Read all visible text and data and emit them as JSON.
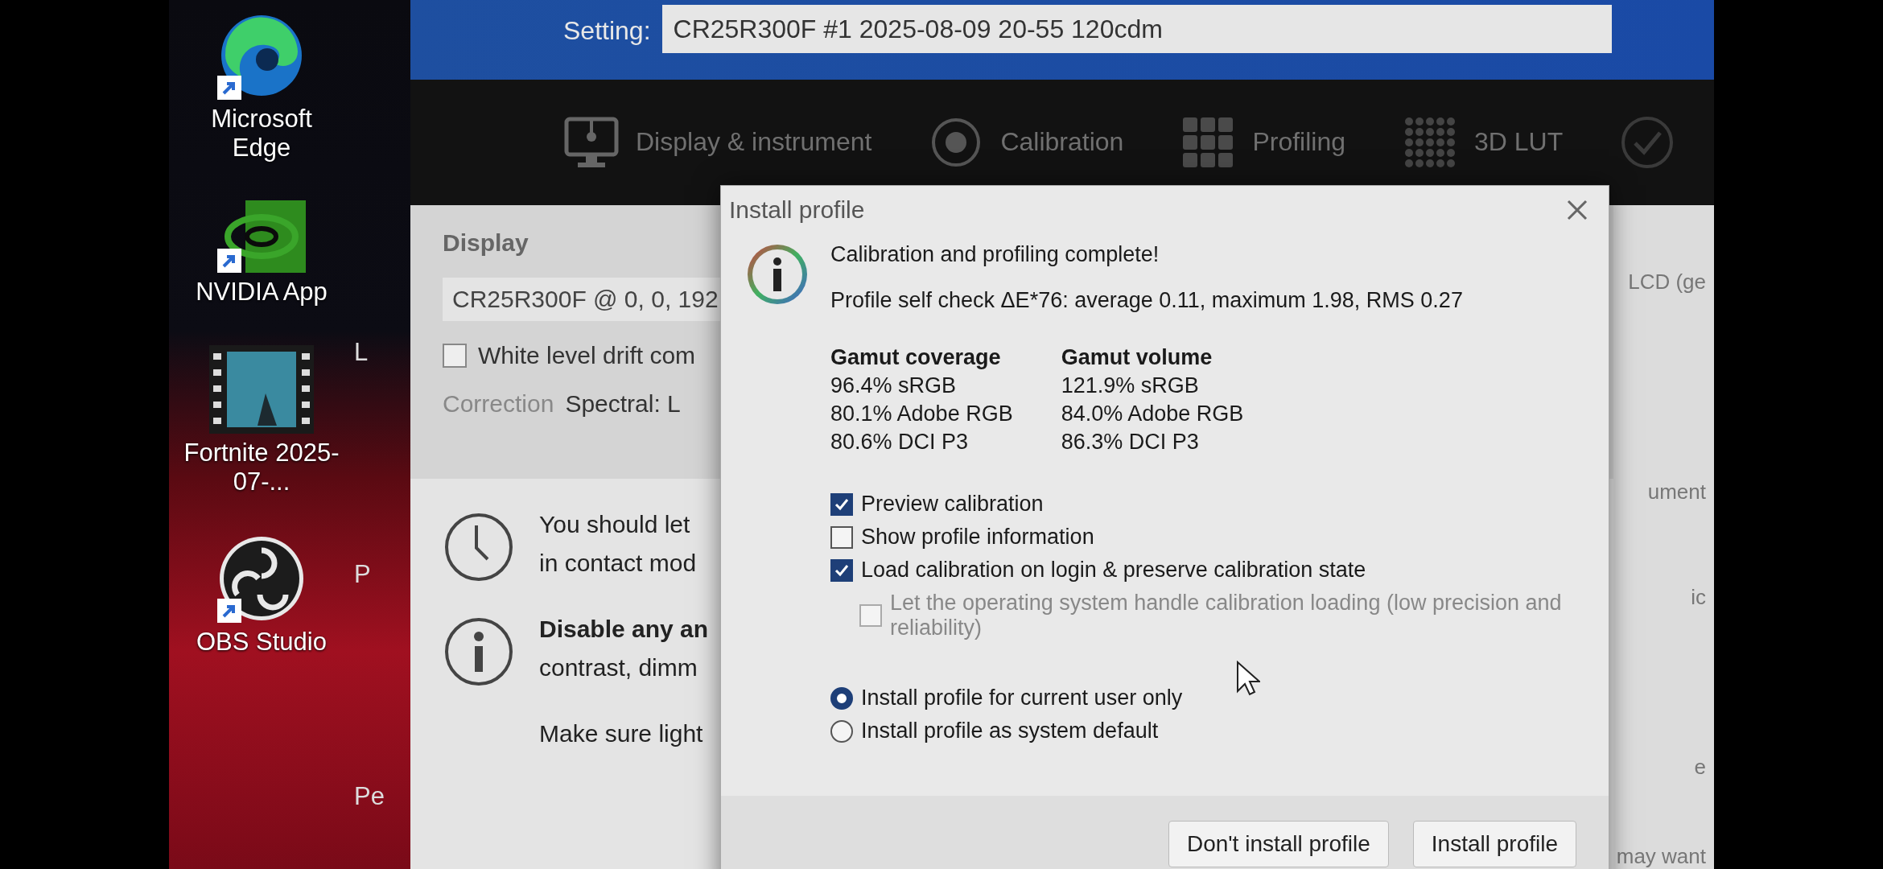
{
  "desktop": {
    "icons": [
      {
        "label": "Microsoft Edge",
        "kind": "edge",
        "shortcut": true
      },
      {
        "label": "NVIDIA App",
        "kind": "nvidia",
        "shortcut": true
      },
      {
        "label": "Fortnite 2025-07-...",
        "kind": "video",
        "shortcut": false
      },
      {
        "label": "OBS Studio",
        "kind": "obs",
        "shortcut": true
      }
    ],
    "partial_labels": [
      "L",
      "P",
      "Pe"
    ]
  },
  "app": {
    "setting_label": "Setting:",
    "setting_value": "CR25R300F #1 2025-08-09 20-55 120cdm",
    "tabs": [
      {
        "label": "Display & instrument",
        "kind": "display"
      },
      {
        "label": "Calibration",
        "kind": "calibration"
      },
      {
        "label": "Profiling",
        "kind": "profiling"
      },
      {
        "label": "3D LUT",
        "kind": "lut"
      },
      {
        "kind": "verification"
      }
    ],
    "display_panel": {
      "title": "Display",
      "display_value": "CR25R300F @ 0, 0, 192",
      "white_drift": {
        "label": "White level drift com",
        "checked": false
      },
      "correction_label": "Correction",
      "correction_value": "Spectral: L"
    },
    "notes": [
      {
        "kind": "clock",
        "lines": [
          "You should let",
          "in contact mod"
        ]
      },
      {
        "kind": "info",
        "heading": "Disable any an",
        "lines": [
          "contrast, dimm"
        ]
      },
      {
        "kind": "plain",
        "lines": [
          "Make sure light"
        ]
      }
    ],
    "right_edge": [
      "LCD (ge",
      "ument",
      "ic",
      "e",
      "may want"
    ]
  },
  "dialog": {
    "title": "Install profile",
    "message": "Calibration and profiling complete!",
    "self_check": "Profile self check ΔE*76: average 0.11, maximum 1.98, RMS 0.27",
    "gamut_coverage": {
      "heading": "Gamut coverage",
      "items": [
        "96.4% sRGB",
        "80.1% Adobe RGB",
        "80.6% DCI P3"
      ]
    },
    "gamut_volume": {
      "heading": "Gamut volume",
      "items": [
        "121.9% sRGB",
        "84.0% Adobe RGB",
        "86.3% DCI P3"
      ]
    },
    "checkboxes": [
      {
        "label": "Preview calibration",
        "checked": true,
        "disabled": false
      },
      {
        "label": "Show profile information",
        "checked": false,
        "disabled": false
      },
      {
        "label": "Load calibration on login & preserve calibration state",
        "checked": true,
        "disabled": false,
        "children": [
          {
            "label": "Let the operating system handle calibration loading (low precision and reliability)",
            "checked": false,
            "disabled": true
          }
        ]
      }
    ],
    "radios": [
      {
        "label": "Install profile for current user only",
        "selected": true
      },
      {
        "label": "Install profile as system default",
        "selected": false
      }
    ],
    "buttons": [
      "Don't install profile",
      "Install profile"
    ]
  }
}
